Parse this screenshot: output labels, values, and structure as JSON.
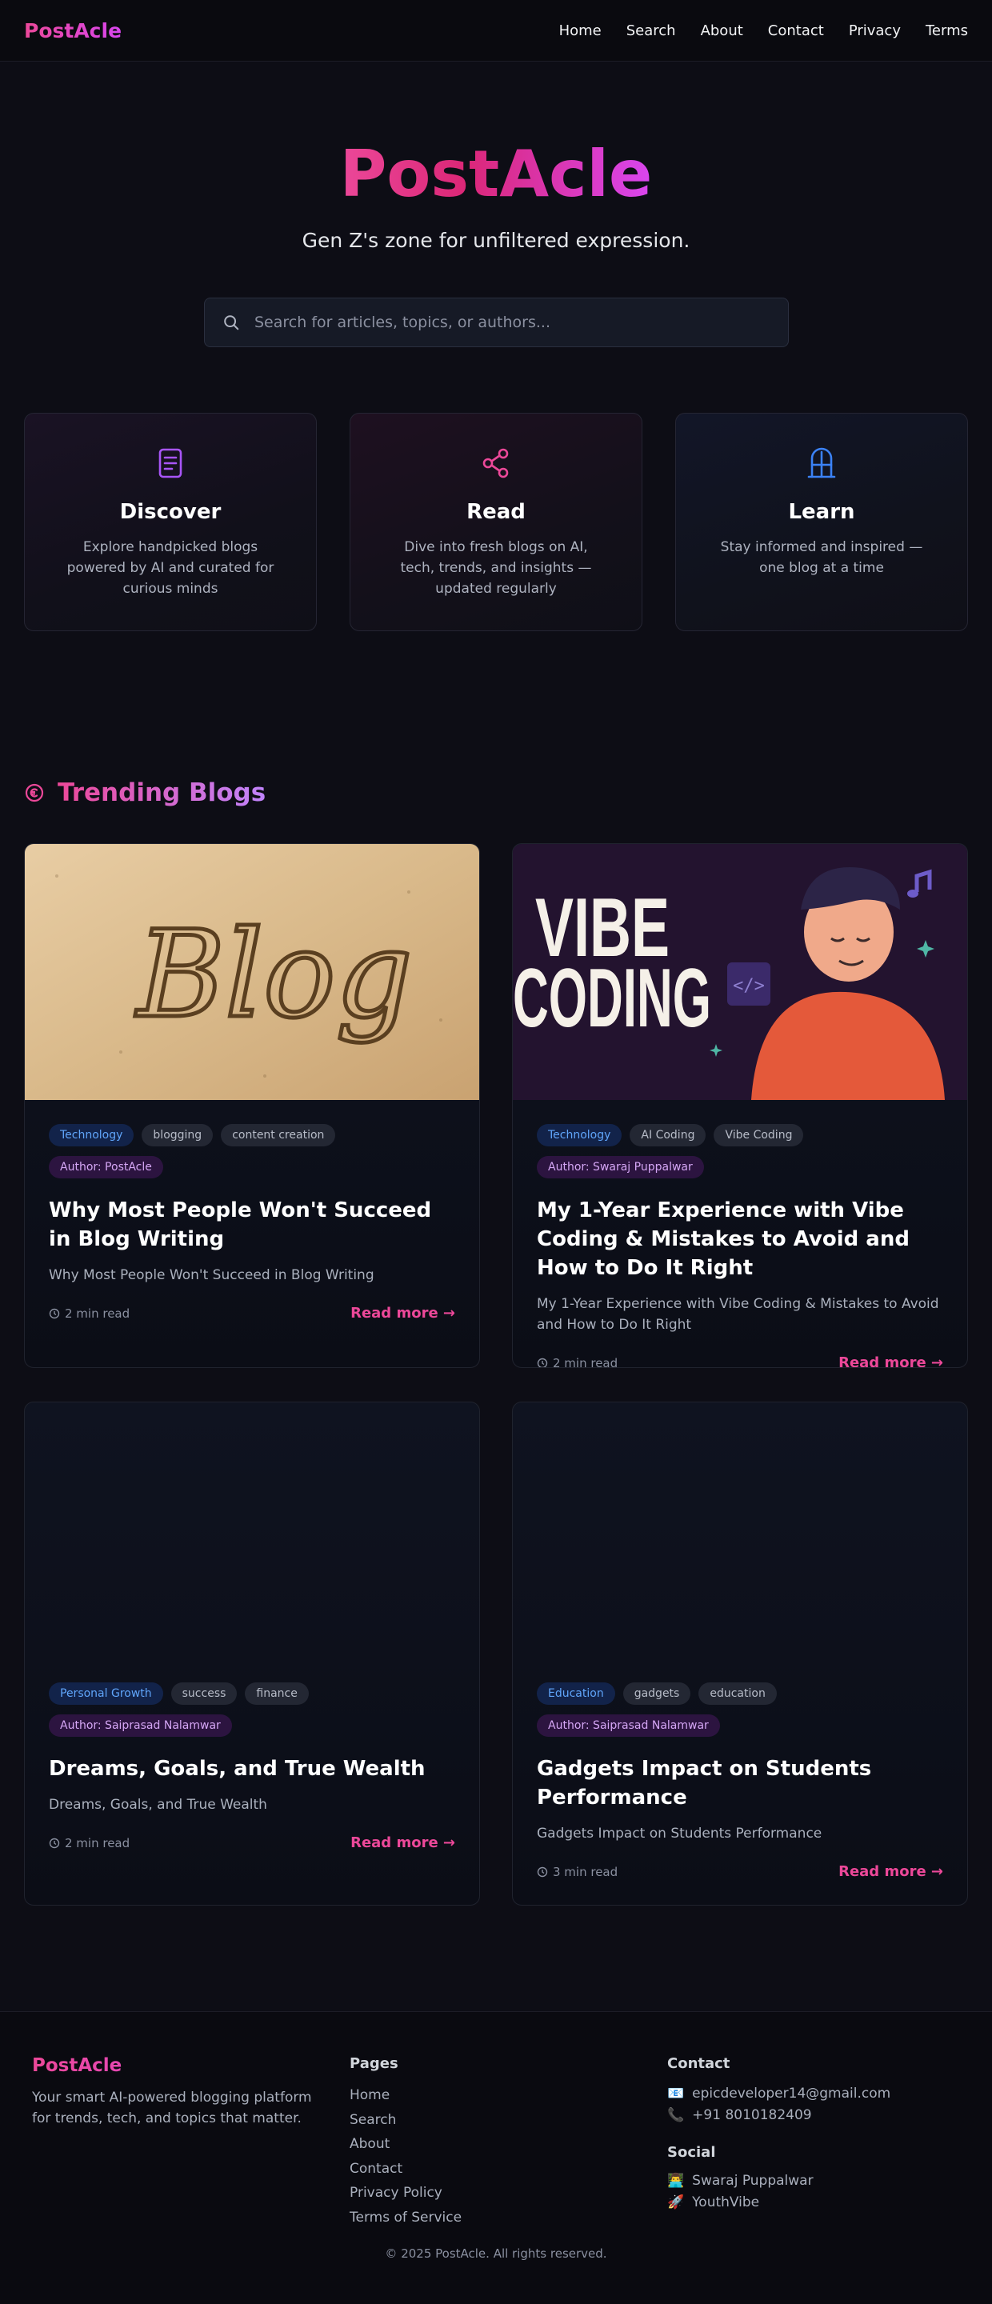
{
  "nav": {
    "brand": "PostAcle",
    "links": [
      "Home",
      "Search",
      "About",
      "Contact",
      "Privacy",
      "Terms"
    ]
  },
  "hero": {
    "title": "PostAcle",
    "subtitle": "Gen Z's zone for unfiltered expression.",
    "search_placeholder": "Search for articles, topics, or authors..."
  },
  "features": [
    {
      "icon": "document-icon",
      "title": "Discover",
      "text": "Explore handpicked blogs powered by AI and curated for curious minds",
      "color": "#a855f7"
    },
    {
      "icon": "share-icon",
      "title": "Read",
      "text": "Dive into fresh blogs on AI, tech, trends, and insights — updated regularly",
      "color": "#ec4899"
    },
    {
      "icon": "door-icon",
      "title": "Learn",
      "text": "Stay informed and inspired — one blog at a time",
      "color": "#3b82f6"
    }
  ],
  "trending": {
    "title": "Trending Blogs",
    "posts": [
      {
        "category": "Technology",
        "tags": [
          "blogging",
          "content creation"
        ],
        "author": "Author: PostAcle",
        "title": "Why Most People Won't Succeed in Blog Writing",
        "excerpt": "Why Most People Won't Succeed in Blog Writing",
        "read_time": "2 min read",
        "read_more": "Read more →",
        "image_text": "Blog"
      },
      {
        "category": "Technology",
        "tags": [
          "AI Coding",
          "Vibe Coding"
        ],
        "author": "Author: Swaraj Puppalwar",
        "title": "My 1-Year Experience with Vibe Coding & Mistakes to Avoid and How to Do It Right",
        "excerpt": "My 1-Year Experience with Vibe Coding & Mistakes to Avoid and How to Do It Right",
        "read_time": "2 min read",
        "read_more": "Read more →",
        "image_text": [
          "VIBE",
          "CODING"
        ]
      },
      {
        "category": "Personal Growth",
        "tags": [
          "success",
          "finance"
        ],
        "author": "Author: Saiprasad Nalamwar",
        "title": "Dreams, Goals, and True Wealth",
        "excerpt": "Dreams, Goals, and True Wealth",
        "read_time": "2 min read",
        "read_more": "Read more →"
      },
      {
        "category": "Education",
        "tags": [
          "gadgets",
          "education"
        ],
        "author": "Author: Saiprasad Nalamwar",
        "title": "Gadgets Impact on Students Performance",
        "excerpt": "Gadgets Impact on Students Performance",
        "read_time": "3 min read",
        "read_more": "Read more →"
      }
    ]
  },
  "footer": {
    "brand": "PostAcle",
    "tagline": "Your smart AI-powered blogging platform for trends, tech, and topics that matter.",
    "pages_heading": "Pages",
    "pages": [
      "Home",
      "Search",
      "About",
      "Contact",
      "Privacy Policy",
      "Terms of Service"
    ],
    "contact_heading": "Contact",
    "email": "epicdeveloper14@gmail.com",
    "phone": "+91 8010182409",
    "social_heading": "Social",
    "socials": [
      "Swaraj Puppalwar",
      "YouthVibe"
    ],
    "copyright": "© 2025 PostAcle. All rights reserved."
  },
  "colors": {
    "accent_pink": "#ec4899",
    "accent_purple": "#d946ef",
    "background": "#0d0d15"
  }
}
